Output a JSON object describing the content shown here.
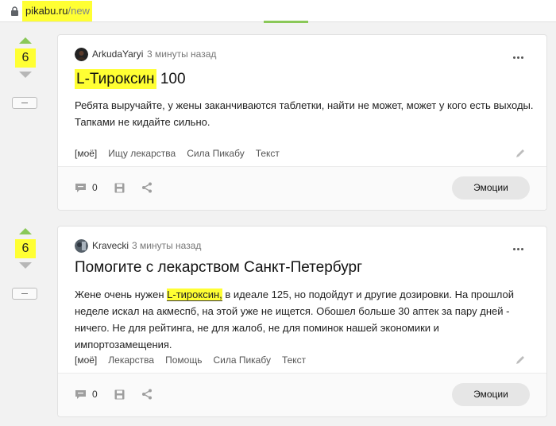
{
  "browser": {
    "url_host": "pikabu.ru",
    "url_path": "/new"
  },
  "posts": [
    {
      "rating": "6",
      "author": "ArkudaYaryi",
      "time": "3 минуты назад",
      "title_highlight": "L-Тироксин",
      "title_rest": " 100",
      "body": [
        {
          "text": "Ребята выручайте, у жены заканчиваются таблетки, найти не может, может у кого есть выходы. Тапками не кидайте сильно."
        }
      ],
      "tags": [
        "[моё]",
        "Ищу лекарства",
        "Сила Пикабу",
        "Текст"
      ],
      "comments": "0",
      "emotions_label": "Эмоции"
    },
    {
      "rating": "6",
      "author": "Kravecki",
      "time": "3 минуты назад",
      "title": "Помогите с лекарством Санкт-Петербург",
      "body_before": "Жене очень нужен ",
      "body_marked": "L-тироксин,",
      "body_after": " в идеале 125, но подойдут и другие дозировки. На прошлой неделе искал на акмеспб, на этой уже не ищется. Обошел больше 30 аптек за пару дней - ничего. Не для рейтинга, не для жалоб, не для поминок нашей экономики и импортозамещения.",
      "tags": [
        "[моё]",
        "Лекарства",
        "Помощь",
        "Сила Пикабу",
        "Текст"
      ],
      "comments": "0",
      "emotions_label": "Эмоции"
    }
  ],
  "colors": {
    "accent": "#8ac858",
    "highlight": "#ffff33"
  }
}
